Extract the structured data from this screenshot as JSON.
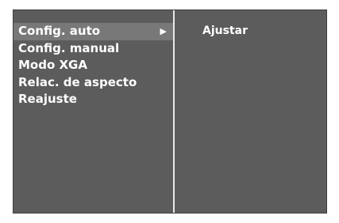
{
  "menu": {
    "items": [
      {
        "label": "Config. auto",
        "selected": true,
        "has_submenu": true,
        "arrow": "▶"
      },
      {
        "label": "Config. manual"
      },
      {
        "label": "Modo XGA"
      },
      {
        "label": "Relac. de aspecto"
      },
      {
        "label": "Reajuste"
      }
    ]
  },
  "submenu": {
    "items": [
      {
        "label": "Ajustar"
      }
    ]
  },
  "colors": {
    "panel_background": "#5c5c5c",
    "selected_background": "#787878",
    "divider": "#e8e8e8",
    "text": "#ffffff"
  }
}
